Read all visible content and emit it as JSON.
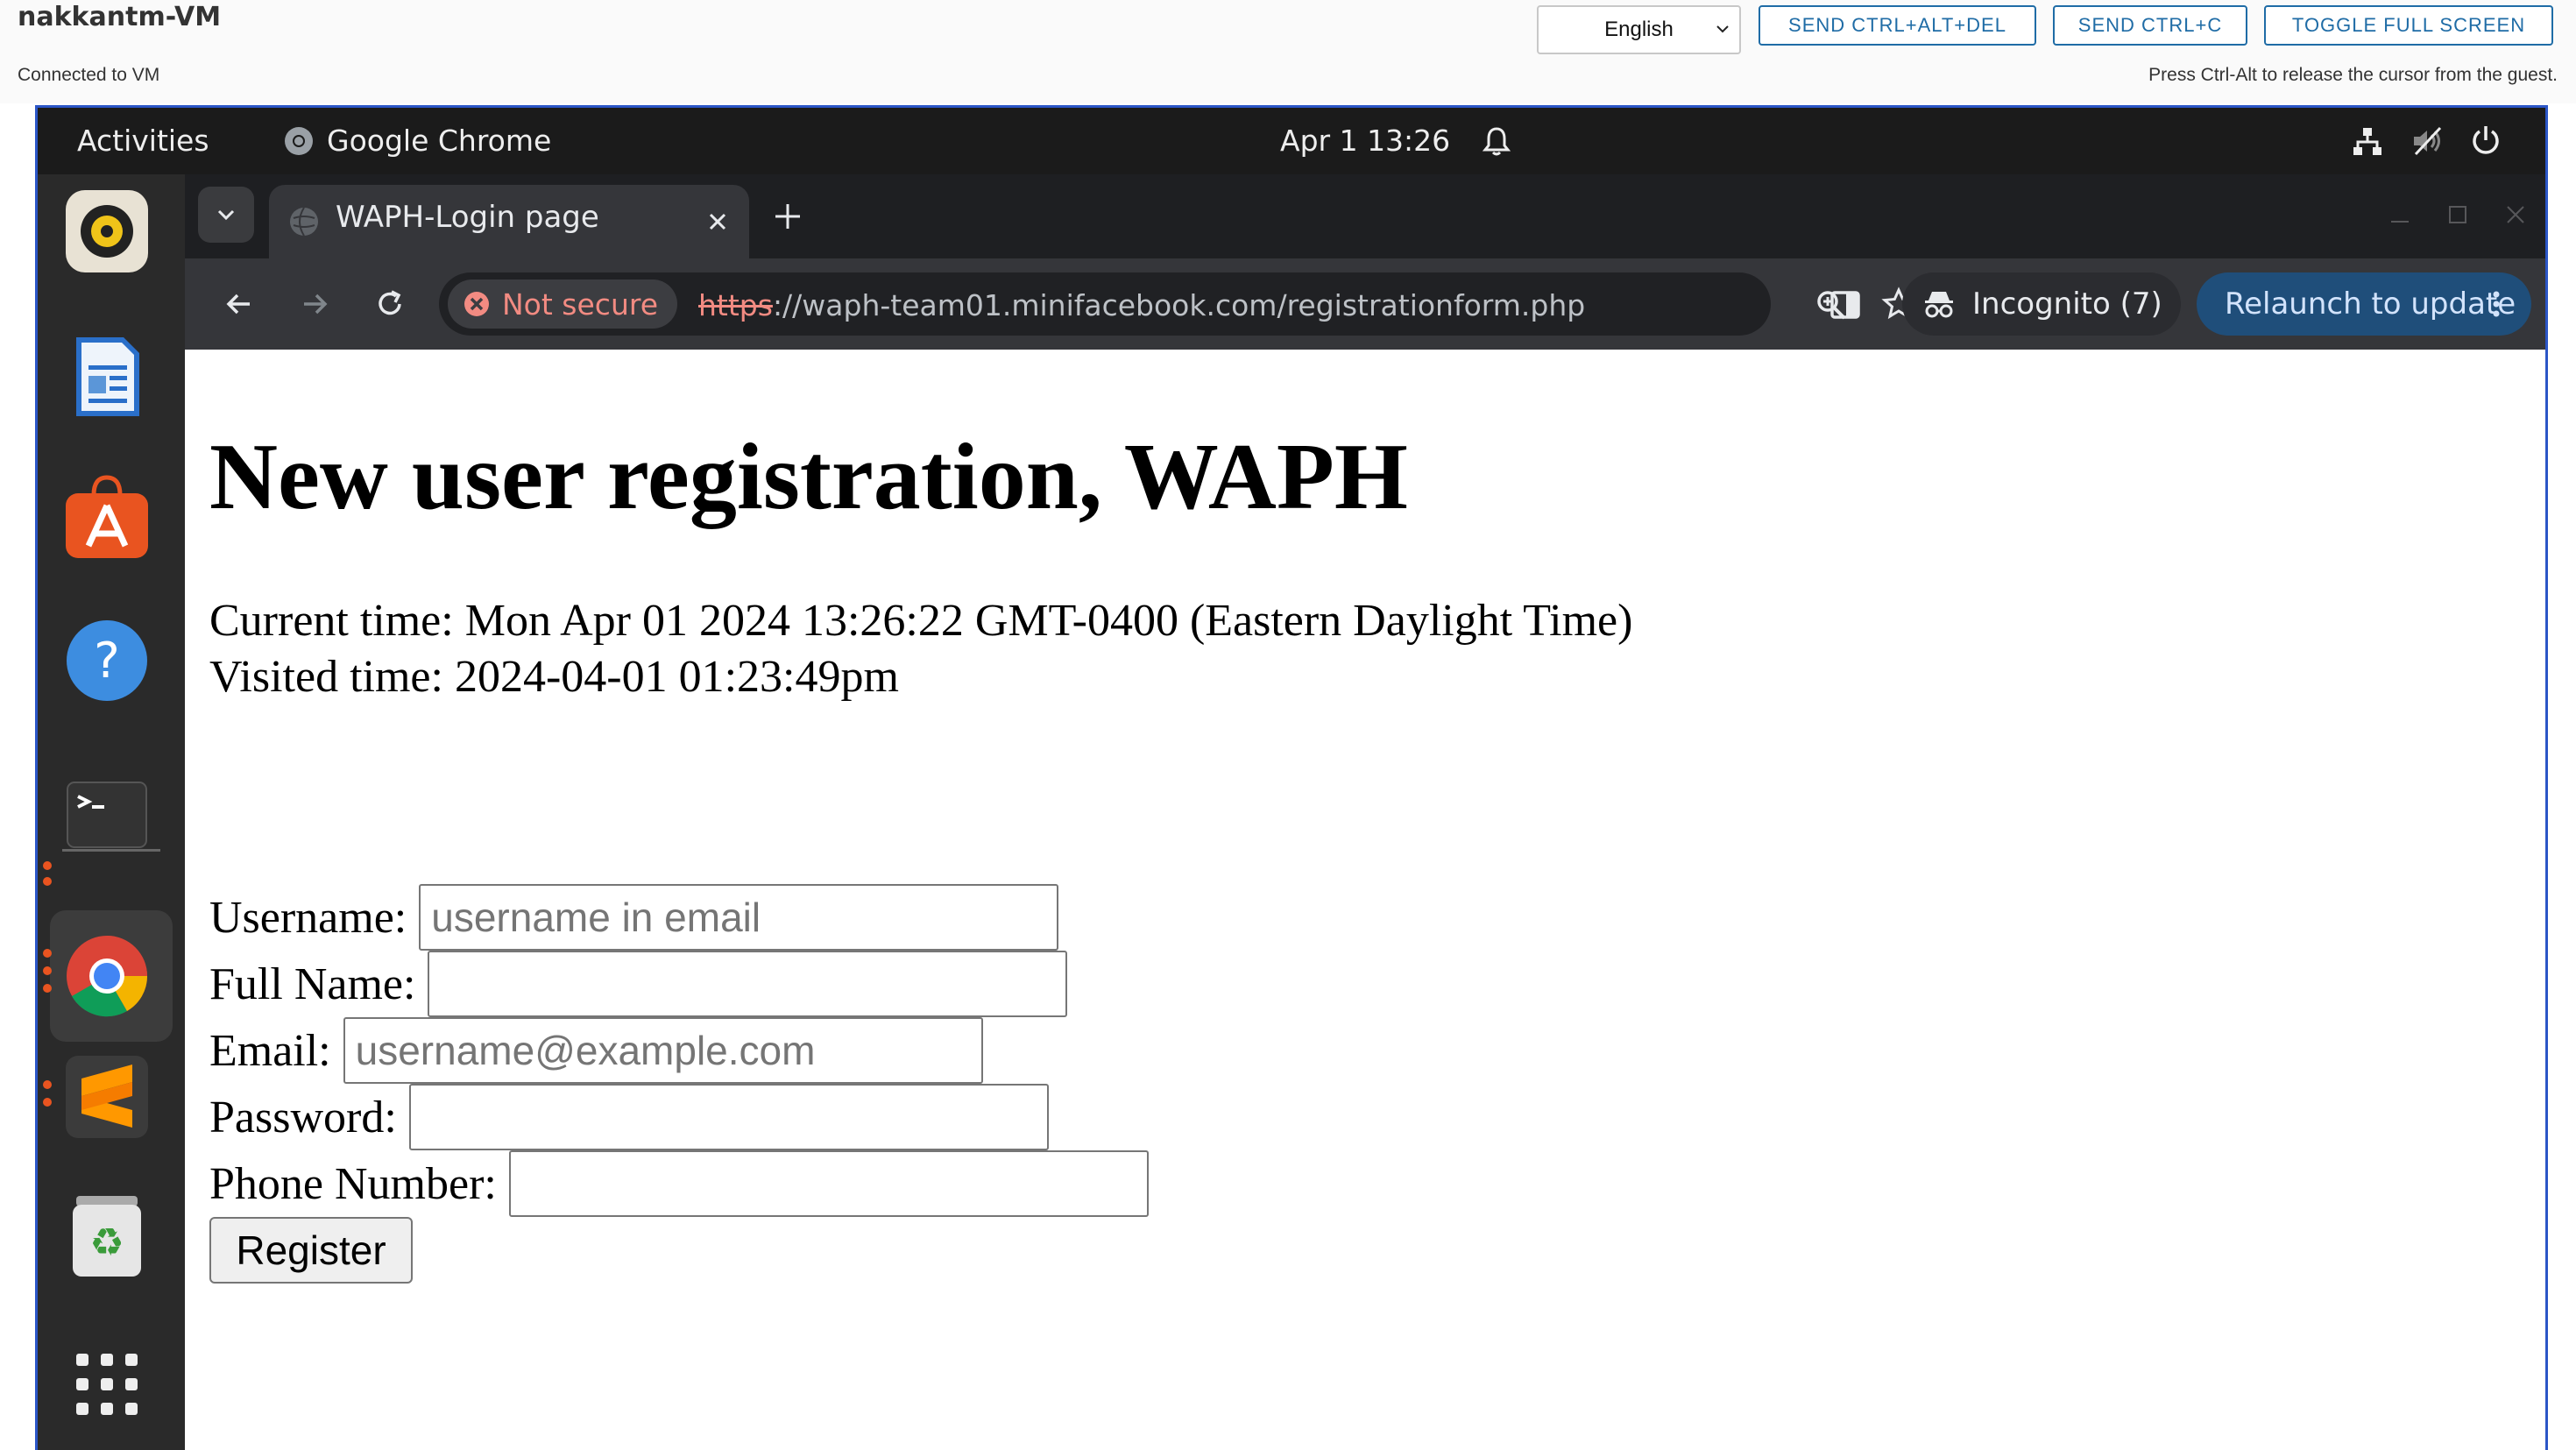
{
  "vm_console": {
    "title": "nakkantm-VM",
    "status": "Connected to VM",
    "hint": "Press Ctrl-Alt to release the cursor from the guest.",
    "language_selected": "English",
    "buttons": {
      "send_cad": "SEND CTRL+ALT+DEL",
      "send_cc": "SEND CTRL+C",
      "toggle_fullscreen": "TOGGLE FULL SCREEN"
    },
    "accent_color": "#1f6ca6"
  },
  "desktop": {
    "activities_label": "Activities",
    "focused_app": "Google Chrome",
    "clock": "Apr 1  13:26",
    "dock_items": [
      "rhythmbox-icon",
      "writer-icon",
      "app-center-icon",
      "help-icon",
      "terminal-icon",
      "chrome-icon",
      "sublime-text-icon",
      "trash-icon",
      "show-apps-icon"
    ]
  },
  "browser": {
    "tab_title": "WAPH-Login page",
    "security_label": "Not secure",
    "url_scheme": "https",
    "url_rest": "://waph-team01.minifacebook.com/registrationform.php",
    "incognito_label": "Incognito (7)",
    "relaunch_label": "Relaunch to update"
  },
  "page": {
    "heading": "New user registration, WAPH",
    "current_time": "Current time: Mon Apr 01 2024 13:26:22 GMT-0400 (Eastern Daylight Time)",
    "visited_time": "Visited time: 2024-04-01 01:23:49pm",
    "form": {
      "username_label": "Username:",
      "username_placeholder": "username in email",
      "fullname_label": "Full Name:",
      "email_label": "Email:",
      "email_placeholder": "username@example.com",
      "password_label": "Password:",
      "phone_label": "Phone Number:",
      "register_label": "Register"
    }
  }
}
